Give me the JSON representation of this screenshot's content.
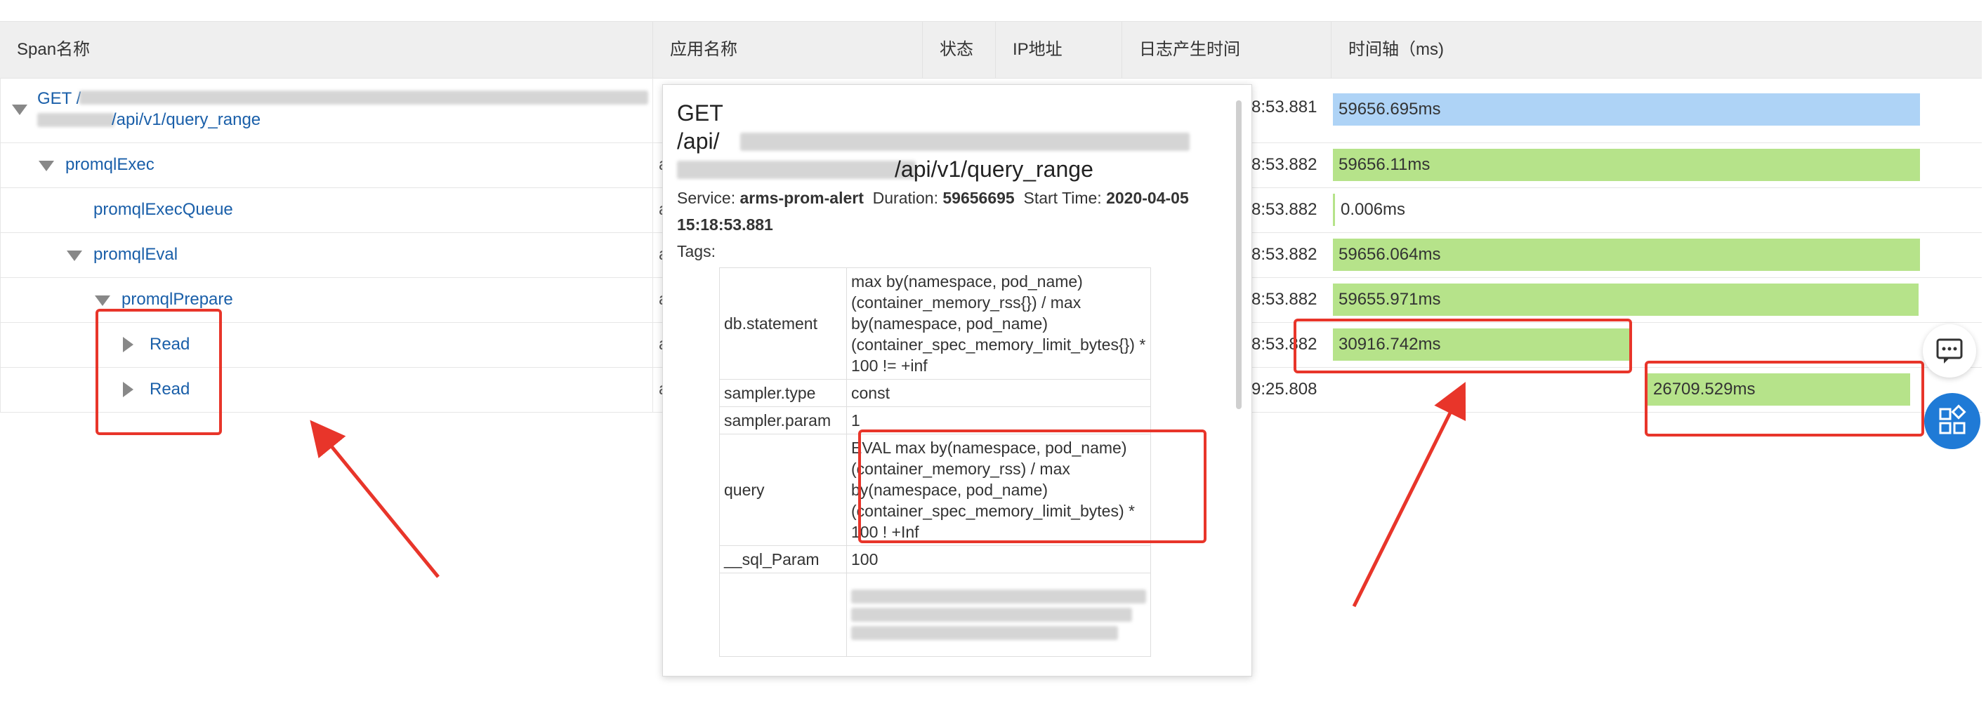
{
  "columns": [
    "Span名称",
    "应用名称",
    "状态",
    "IP地址",
    "日志产生时间",
    "时间轴（ms)"
  ],
  "rows": [
    {
      "name_line1": "GET /",
      "name_line2": "/api/v1/query_range",
      "app": "",
      "time": "8:53.881",
      "duration": "59656.695ms"
    },
    {
      "name": "promqlExec",
      "app": "a",
      "time": "8:53.882",
      "duration": "59656.11ms"
    },
    {
      "name": "promqlExecQueue",
      "app": "a",
      "time": "8:53.882",
      "duration": "0.006ms"
    },
    {
      "name": "promqlEval",
      "app": "a",
      "time": "8:53.882",
      "duration": "59656.064ms"
    },
    {
      "name": "promqlPrepare",
      "app": "a",
      "time": "8:53.882",
      "duration": "59655.971ms"
    },
    {
      "name": "Read",
      "app": "a",
      "time": "8:53.882",
      "duration": "30916.742ms"
    },
    {
      "name": "Read",
      "app": "a",
      "time": "9:25.808",
      "duration": "26709.529ms"
    }
  ],
  "popup": {
    "title_line1": "GET",
    "title_line2": "/api/",
    "title_line3": "/api/v1/query_range",
    "service_label": "Service:",
    "service_value": "arms-prom-alert",
    "duration_label": "Duration:",
    "duration_value": "59656695",
    "start_label": "Start Time:",
    "start_value_1": "2020-04-05",
    "start_value_2": "15:18:53.881",
    "tags_label": "Tags:",
    "tags": [
      {
        "key": "db.statement",
        "value": "max by(namespace, pod_name) (container_memory_rss{}) / max by(namespace, pod_name) (container_spec_memory_limit_bytes{}) * 100 != +inf"
      },
      {
        "key": "sampler.type",
        "value": "const"
      },
      {
        "key": "sampler.param",
        "value": "1"
      },
      {
        "key": "query",
        "value": "EVAL max by(namespace, pod_name) (container_memory_rss) / max by(namespace, pod_name) (container_spec_memory_limit_bytes) * 100 ! +Inf"
      },
      {
        "key": "__sql_Param",
        "value": "100"
      },
      {
        "key": "",
        "value": ""
      }
    ]
  },
  "colors": {
    "link": "#1a5fa9",
    "bar_blue": "#aed3f6",
    "bar_green": "#b6e38a",
    "annotation_red": "#e8352a",
    "fab_blue": "#1f7ad6"
  },
  "icons": [
    "expand-triangle-icon",
    "collapse-triangle-icon",
    "chat-icon",
    "apps-grid-icon"
  ]
}
